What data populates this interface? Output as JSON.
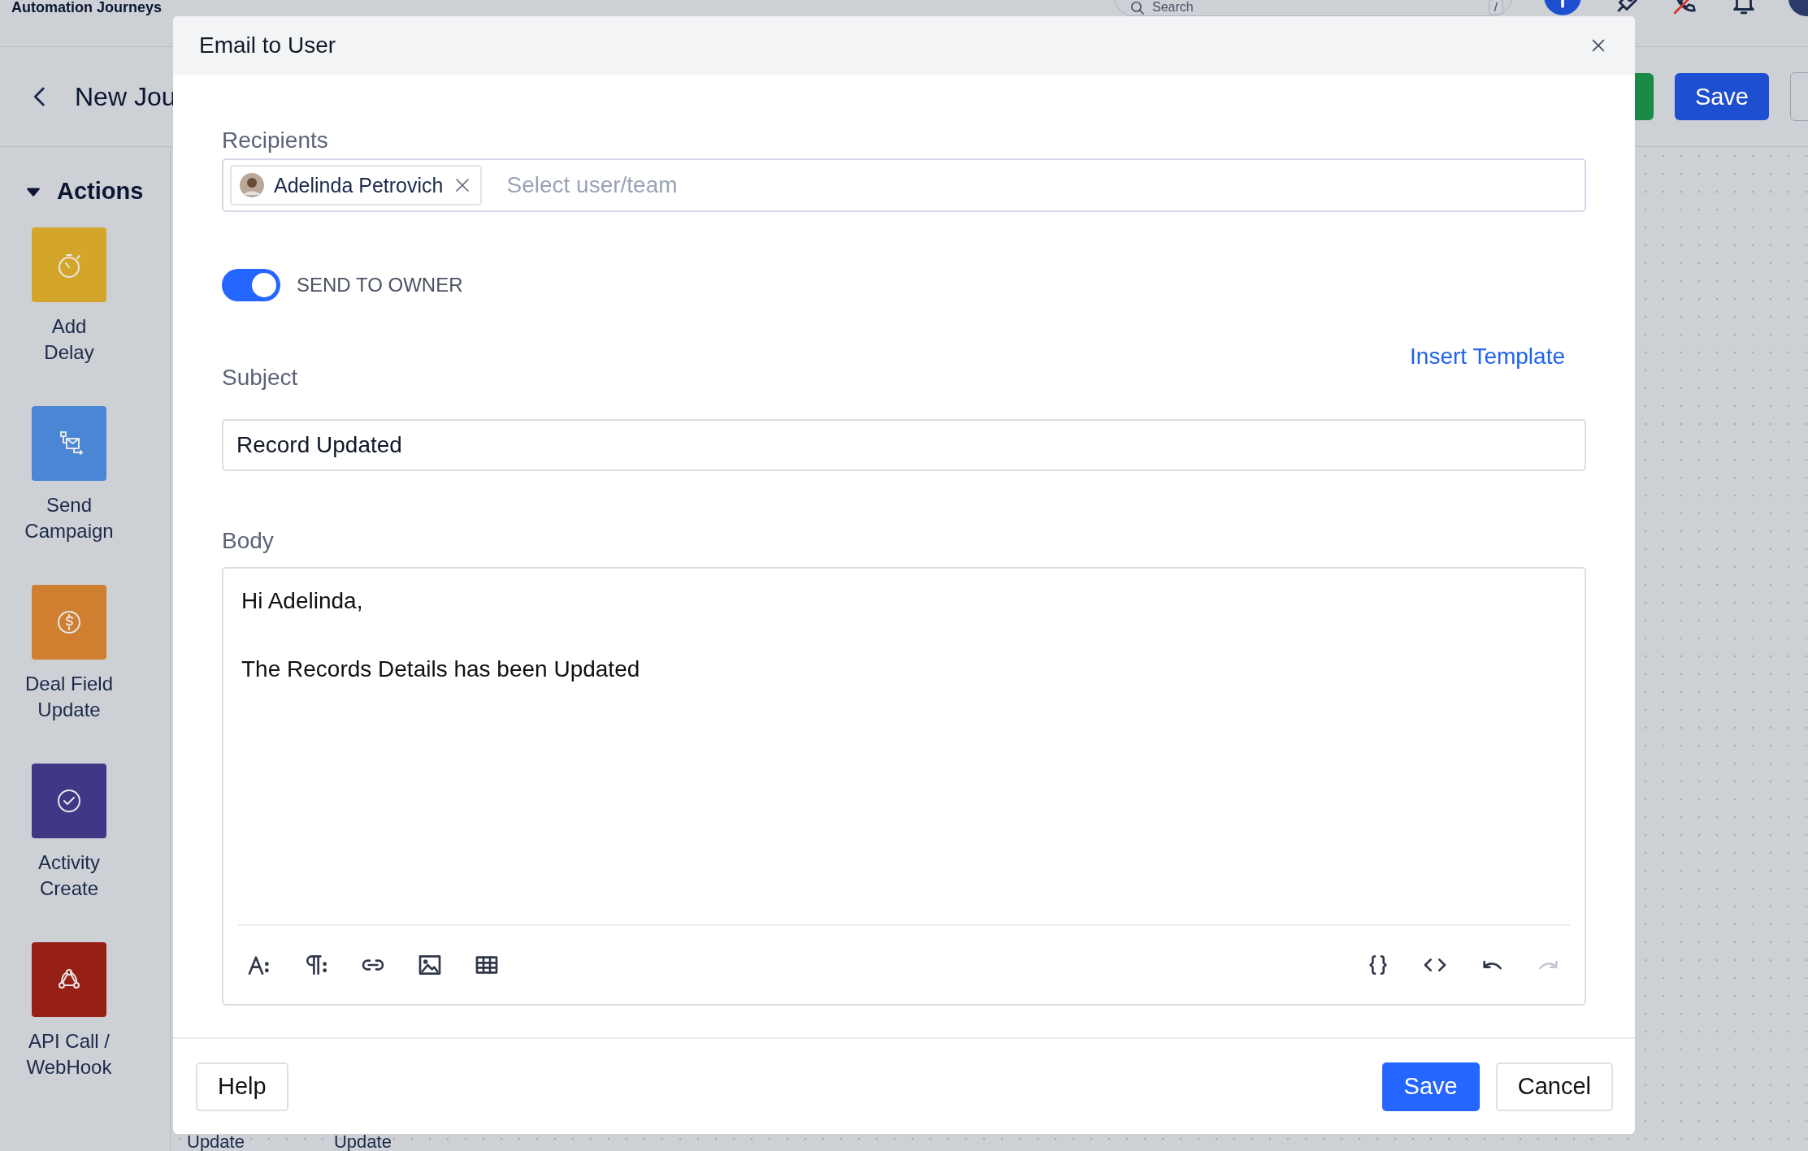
{
  "app": {
    "title": "Automation Journeys",
    "search": {
      "placeholder": "Search"
    },
    "shortcut": "/",
    "header": {
      "title": "New Jou",
      "save": "Save"
    },
    "sidebar": {
      "section": "Actions",
      "expanded": true,
      "items": [
        {
          "label": "Add Delay",
          "kind": "delay",
          "color": "#d4a52b"
        },
        {
          "label": "Send Campaign",
          "kind": "campaign",
          "color": "#4a86d4"
        },
        {
          "label": "Deal Field Update",
          "kind": "currency",
          "color": "#d07f30"
        },
        {
          "label": "Activity Create",
          "kind": "check",
          "color": "#403886"
        },
        {
          "label": "API Call / WebHook",
          "kind": "webhook",
          "color": "#962015"
        }
      ]
    },
    "canvas_labels": [
      "Update",
      "Update"
    ]
  },
  "dialog": {
    "title": "Email to User",
    "recipients": {
      "label": "Recipients",
      "chips": [
        {
          "name": "Adelinda Petrovich"
        }
      ],
      "placeholder": "Select user/team"
    },
    "send_to_owner": {
      "label": "SEND TO OWNER",
      "on": true
    },
    "subject": {
      "label": "Subject",
      "value": "Record Updated",
      "insert_template": "Insert Template"
    },
    "body": {
      "label": "Body",
      "paragraphs": [
        "Hi Adelinda,",
        "The Records Details has been Updated"
      ]
    },
    "toolbar": [
      {
        "kind": "font",
        "disabled": false
      },
      {
        "kind": "paragraph",
        "disabled": false
      },
      {
        "kind": "link",
        "disabled": false
      },
      {
        "kind": "image",
        "disabled": false
      },
      {
        "kind": "table",
        "disabled": false
      },
      {
        "kind": "gap"
      },
      {
        "kind": "braces",
        "disabled": false
      },
      {
        "kind": "code",
        "disabled": false
      },
      {
        "kind": "undo",
        "disabled": false
      },
      {
        "kind": "redo",
        "disabled": true
      }
    ],
    "buttons": {
      "help": "Help",
      "save": "Save",
      "cancel": "Cancel"
    }
  }
}
